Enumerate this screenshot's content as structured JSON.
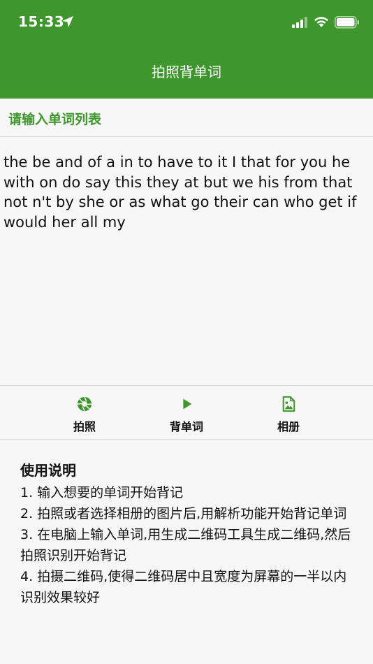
{
  "status_bar": {
    "time": "15:33"
  },
  "nav": {
    "title": "拍照背单词"
  },
  "section": {
    "header": "请输入单词列表"
  },
  "input": {
    "value": "the be and of a in to have to it I that for you he with on do say this they at but we his from that not n't by she or as what go their can who get if would her all my"
  },
  "toolbar": {
    "items": [
      {
        "label": "拍照",
        "icon": "camera-aperture-icon"
      },
      {
        "label": "背单词",
        "icon": "play-icon"
      },
      {
        "label": "相册",
        "icon": "image-file-icon"
      }
    ]
  },
  "instructions": {
    "title": "使用说明",
    "items": [
      "1. 输入想要的单词开始背记",
      "2. 拍照或者选择相册的图片后,用解析功能开始背记单词",
      "3. 在电脑上输入单词,用生成二维码工具生成二维码,然后拍照识别开始背记",
      "4. 拍摄二维码,使得二维码居中且宽度为屏幕的一半以内识别效果较好"
    ]
  },
  "colors": {
    "brand": "#3e962d",
    "background": "#f7f7f7",
    "text": "#111111"
  }
}
